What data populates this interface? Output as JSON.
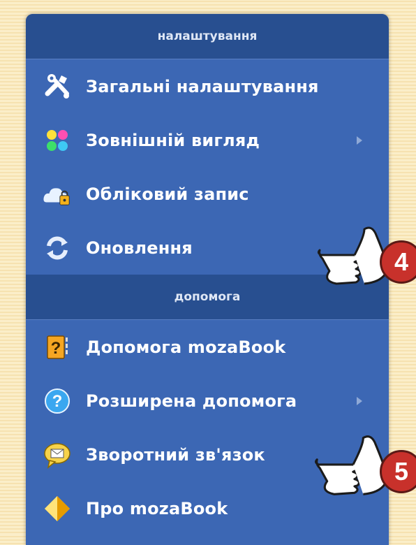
{
  "menu": {
    "settings_header": "налаштування",
    "help_header": "допомога",
    "items": [
      {
        "label": "Загальні налаштування",
        "icon": "tools-icon"
      },
      {
        "label": "Зовнішній вигляд",
        "icon": "color-dots-icon",
        "submenu": true
      },
      {
        "label": "Обліковий запис",
        "icon": "cloud-lock-icon"
      },
      {
        "label": "Оновлення",
        "icon": "refresh-icon"
      },
      {
        "label": "Допомога mozaBook",
        "icon": "help-book-icon"
      },
      {
        "label": "Розширена допомога",
        "icon": "help-circle-icon",
        "submenu": true
      },
      {
        "label": "Зворотний зв'язок",
        "icon": "feedback-mail-icon"
      },
      {
        "label": "Про mozaBook",
        "icon": "diamond-logo-icon"
      }
    ]
  },
  "callouts": [
    {
      "number": "4",
      "target": "Оновлення"
    },
    {
      "number": "5",
      "target": "Зворотний зв'язок"
    }
  ],
  "colors": {
    "menu_bg": "#3c67b4",
    "header_bg": "#284f90",
    "badge": "#c8312b",
    "page_bg": "#fbeec9"
  }
}
